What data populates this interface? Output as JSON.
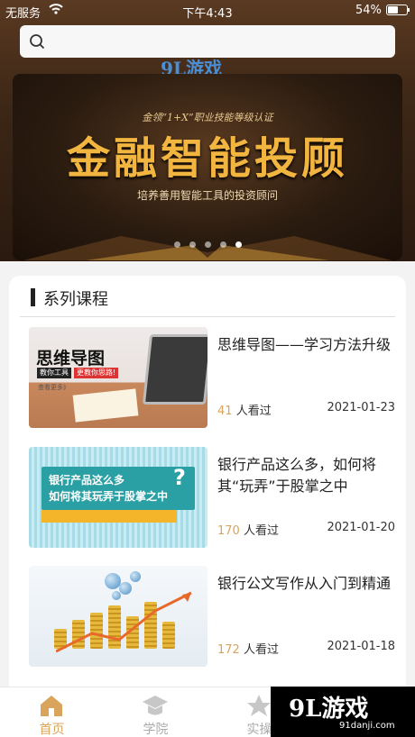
{
  "status_bar": {
    "carrier": "无服务",
    "time": "下午4:43",
    "battery_pct": "54%",
    "battery_level": 0.54
  },
  "search": {
    "placeholder": "",
    "value": ""
  },
  "watermark": {
    "brand": "9L游戏",
    "domain": "91danji.com"
  },
  "banner": {
    "subtitle_top": "金领“1+X”职业技能等级认证",
    "headline": "金融智能投顾",
    "caption": "培养善用智能工具的投资顾问",
    "dot_count": 5,
    "active_dot": 4
  },
  "section": {
    "title": "系列课程"
  },
  "courses": [
    {
      "title": "思维导图——学习方法升级",
      "views": "41",
      "views_suffix": "人看过",
      "date": "2021-01-23",
      "thumb": {
        "title": "思维导图",
        "tag1": "教你工具",
        "tag2": "更教你思路!",
        "more": "查看更多》"
      }
    },
    {
      "title": "银行产品这么多，如何将其“玩弄”于股掌之中",
      "views": "170",
      "views_suffix": "人看过",
      "date": "2021-01-20",
      "thumb": {
        "line1": "银行产品这么多",
        "line2": "如何将其玩弄于股掌之中",
        "q": "?"
      }
    },
    {
      "title": "银行公文写作从入门到精通",
      "views": "172",
      "views_suffix": "人看过",
      "date": "2021-01-18"
    }
  ],
  "tabs": [
    {
      "label": "首页",
      "icon": "home-icon",
      "active": true
    },
    {
      "label": "学院",
      "icon": "graduation-cap-icon",
      "active": false
    },
    {
      "label": "实操",
      "icon": "star-icon",
      "active": false
    }
  ],
  "colors": {
    "accent": "#d9a45b",
    "banner_gold": "#f2b640",
    "top_bg": "#3d2716"
  }
}
